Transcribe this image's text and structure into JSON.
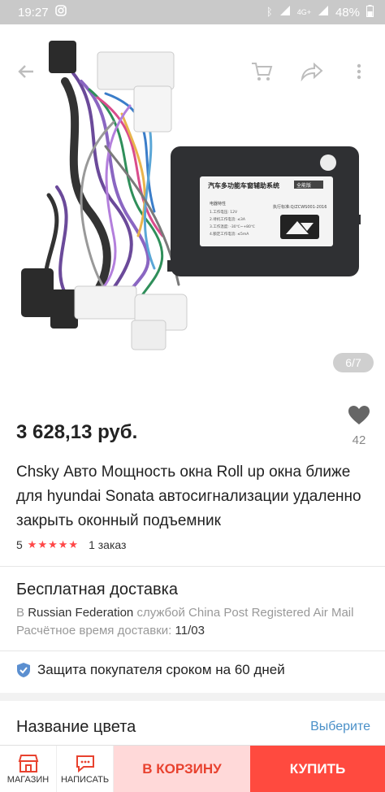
{
  "status_bar": {
    "time": "19:27",
    "network": "4G+",
    "battery": "48%",
    "icons": [
      "instagram-icon",
      "bluetooth-icon",
      "signal-icon",
      "battery-icon"
    ]
  },
  "gallery": {
    "counter": "6/7",
    "module_label_title": "汽车多功能车窗辅助系统",
    "module_label_badge": "全能版",
    "module_label_std": "执行标准:Q/ZCWS001-2016",
    "module_label_section": "电器特性",
    "module_label_lines": [
      "1.工作电压: 12V",
      "2.待机工作电流: ≤3A",
      "3.工作温度: -30℃~+80℃",
      "4.额定工作电流: ≤5mA"
    ]
  },
  "product": {
    "price": "3 628,13 руб.",
    "wishlist_count": "42",
    "title": "Chsky Авто Мощность окна Roll up окна ближе для hyundai Sonata автосигнализации удаленно закрыть оконный подъемник",
    "rating_value": "5",
    "stars": "★★★★★",
    "orders": "1 заказ"
  },
  "delivery": {
    "title": "Бесплатная доставка",
    "line1_prefix": "В",
    "line1_country": "Russian Federation",
    "line1_suffix": "службой China Post Registered Air Mail",
    "line2_label": "Расчётное время доставки:",
    "line2_value": "11/03"
  },
  "protection": {
    "text": "Защита покупателя сроком на 60 дней"
  },
  "color": {
    "title": "Название цвета",
    "action": "Выберите"
  },
  "bottom_bar": {
    "store_label": "МАГАЗИН",
    "message_label": "НАПИСАТЬ",
    "cart_label": "В КОРЗИНУ",
    "buy_label": "КУПИТЬ"
  },
  "colors": {
    "accent_red": "#ff4a3f",
    "cart_bg": "#ffd9d9",
    "link_blue": "#4a90c8"
  }
}
